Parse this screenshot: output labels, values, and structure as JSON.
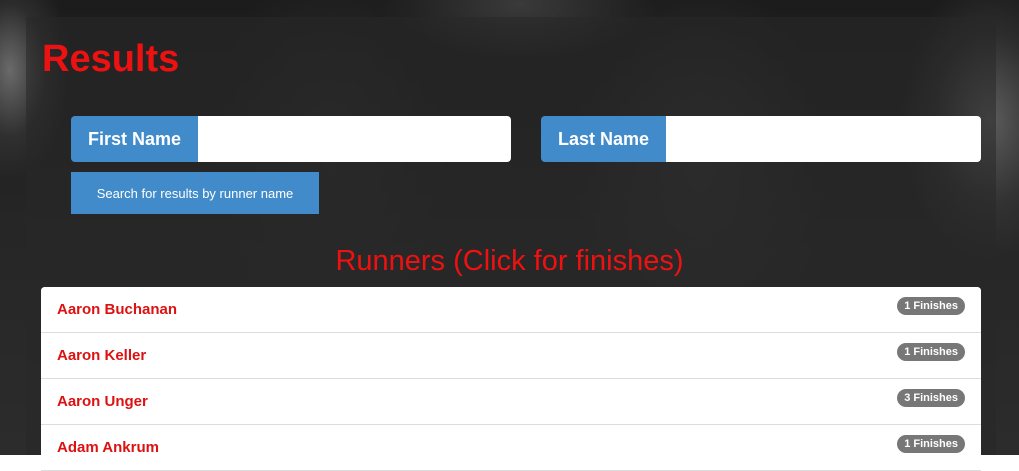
{
  "page": {
    "title": "Results"
  },
  "search": {
    "first_name_label": "First Name",
    "first_name_value": "",
    "last_name_label": "Last Name",
    "last_name_value": "",
    "button_label": "Search for results by runner name"
  },
  "runners_section": {
    "title": "Runners (Click for finishes)"
  },
  "runners": [
    {
      "name": "Aaron Buchanan",
      "finishes": "1 Finishes"
    },
    {
      "name": "Aaron Keller",
      "finishes": "1 Finishes"
    },
    {
      "name": "Aaron Unger",
      "finishes": "3 Finishes"
    },
    {
      "name": "Adam Ankrum",
      "finishes": "1 Finishes"
    }
  ],
  "colors": {
    "accent_red": "#ee1111",
    "button_blue": "#428bca",
    "badge_gray": "#777777"
  }
}
